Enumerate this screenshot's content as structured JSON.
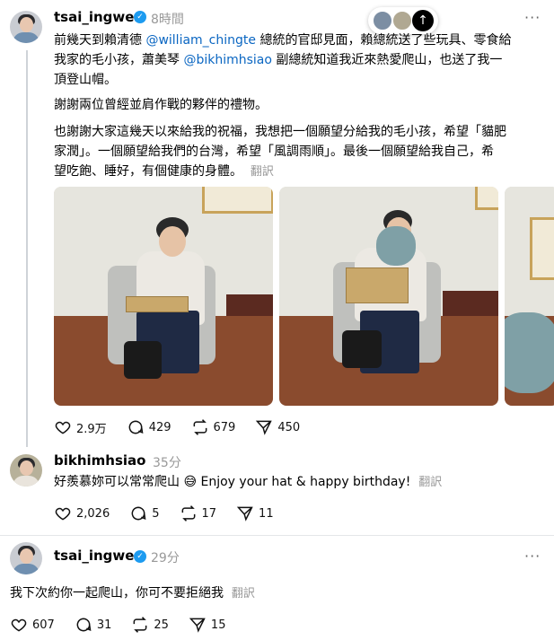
{
  "post": {
    "username": "tsai_ingwen",
    "time": "8時間",
    "more": "···",
    "para1": {
      "t1": "前幾天到賴清德 ",
      "m1": "@william_chingte",
      "t2": " 總統的官邸見面，賴總統送了些玩具、零食給",
      "t3": "我家的毛小孩，蕭美琴 ",
      "m2": "@bikhimhsiao",
      "t4": " 副總統知道我近來熱愛爬山，也送了我一",
      "t5": "頂登山帽。"
    },
    "para2": "謝謝兩位曾經並肩作戰的夥伴的禮物。",
    "para3": {
      "l1": "也謝謝大家這幾天以來給我的祝福，我想把一個願望分給我的毛小孩，希望「貓肥",
      "l2": "家潤」。一個願望給我們的台灣，希望「風調雨順」。最後一個願望給我自己，希",
      "l3": "望吃飽、睡好，有個健康的身體。"
    },
    "translate": "翻訳",
    "likes": "2.9万",
    "replies": "429",
    "reposts": "679",
    "shares": "450"
  },
  "reply1": {
    "username": "bikhimhsiao",
    "time": "35分",
    "text": "好羨慕妳可以常常爬山 😅 Enjoy your hat & happy birthday!",
    "translate": "翻訳",
    "likes": "2,026",
    "replies": "5",
    "reposts": "17",
    "shares": "11"
  },
  "reply2": {
    "username": "tsai_ingwen",
    "time": "29分",
    "more": "···",
    "text": "我下次約你一起爬山，你可不要拒絕我",
    "translate": "翻訳",
    "likes": "607",
    "replies": "31",
    "reposts": "25",
    "shares": "15"
  },
  "scroll_button": {
    "arrow": "↑"
  },
  "colors": {
    "link": "#0a66c2",
    "verified": "#1d9bf0",
    "muted": "#999999"
  }
}
